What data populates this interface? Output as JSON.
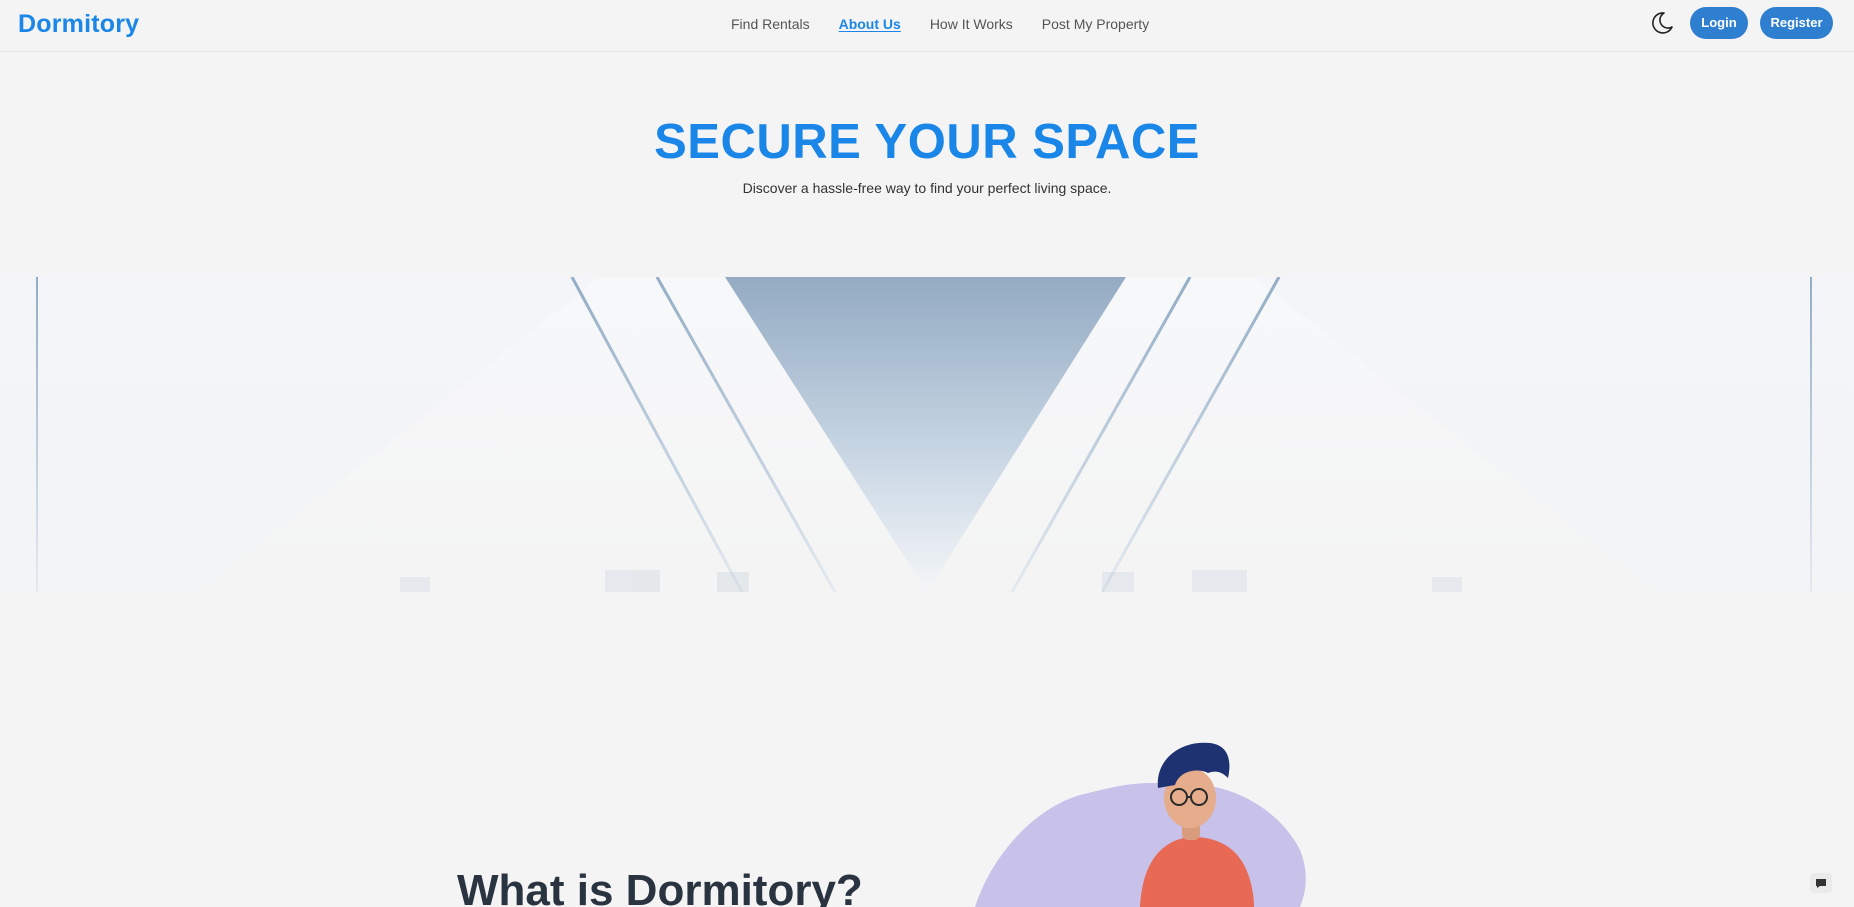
{
  "header": {
    "logo": "Dormitory",
    "nav": [
      {
        "label": "Find Rentals",
        "active": false
      },
      {
        "label": "About Us",
        "active": true
      },
      {
        "label": "How It Works",
        "active": false
      },
      {
        "label": "Post My Property",
        "active": false
      }
    ],
    "theme_icon": "moon-icon",
    "login_label": "Login",
    "register_label": "Register"
  },
  "hero": {
    "title": "SECURE YOUR SPACE",
    "subtitle": "Discover a hassle-free way to find your perfect living space."
  },
  "about": {
    "title": "What is Dormitory?"
  },
  "colors": {
    "brand": "#1a86e8",
    "button": "#2f7fd1",
    "background": "#f4f4f4",
    "heading": "#2a3441"
  },
  "icons": {
    "chat": "chat-icon"
  }
}
